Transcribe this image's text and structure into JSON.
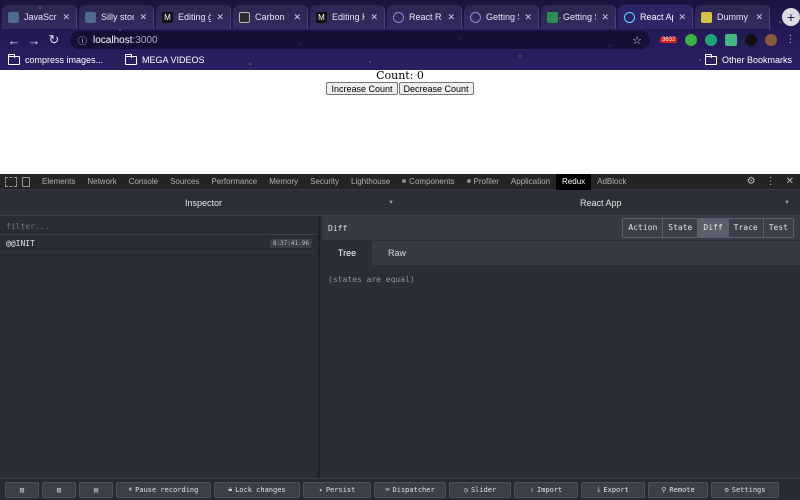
{
  "browser": {
    "tabs": [
      {
        "label": "JavaScrip",
        "fav_color": "#4a6b8a"
      },
      {
        "label": "Silly stor",
        "fav_color": "#4a6b8a"
      },
      {
        "label": "Editing gu",
        "fav_color": "#111111"
      },
      {
        "label": "Carbon",
        "fav_color": "#2b2b2b"
      },
      {
        "label": "Editing H",
        "fav_color": "#111111"
      },
      {
        "label": "React Re",
        "fav_color": "#764abc"
      },
      {
        "label": "Getting S",
        "fav_color": "#764abc"
      },
      {
        "label": "Getting S",
        "fav_color": "#2e8b57"
      },
      {
        "label": "React Ap",
        "fav_color": "#61dafb",
        "active": true
      },
      {
        "label": "Dummy I",
        "fav_color": "#d4c34a"
      }
    ],
    "new_tab": "+",
    "url_host": "localhost",
    "url_port": ":3000",
    "ext_badge": "3632",
    "bookmarks": [
      {
        "label": "compress images..."
      },
      {
        "label": "MEGA VIDEOS"
      }
    ],
    "other_bookmarks": "Other Bookmarks"
  },
  "page": {
    "count_text": "Count: 0",
    "increase_label": "Increase Count",
    "decrease_label": "Decrease Count"
  },
  "devtools": {
    "tabs": [
      "Elements",
      "Network",
      "Console",
      "Sources",
      "Performance",
      "Memory",
      "Security",
      "Lighthouse",
      "Components",
      "Profiler",
      "Application",
      "Redux",
      "AdBlock"
    ],
    "active_tab": "Redux",
    "redux": {
      "left_header": "Inspector",
      "right_header": "React App",
      "filter_placeholder": "filter...",
      "actions": [
        {
          "name": "@@INIT",
          "time": "8:37:41.96"
        }
      ],
      "diff_title": "Diff",
      "modes": [
        "Action",
        "State",
        "Diff",
        "Trace",
        "Test"
      ],
      "active_mode": "Diff",
      "subtabs": [
        "Tree",
        "Raw"
      ],
      "active_subtab": "Tree",
      "empty_message": "(states are equal)",
      "bottom_buttons": [
        "Pause recording",
        "Lock changes",
        "Persist",
        "Dispatcher",
        "Slider",
        "Import",
        "Export",
        "Remote",
        "Settings"
      ]
    }
  }
}
